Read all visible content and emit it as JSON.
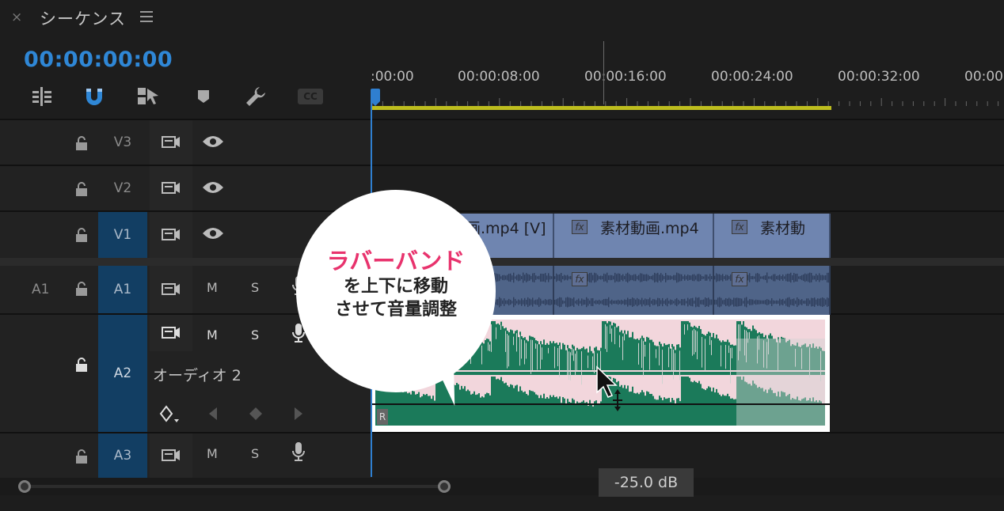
{
  "panel": {
    "close_glyph": "×",
    "title": "シーケンス",
    "timecode": "00:00:00:00"
  },
  "toolbar": {
    "icons": [
      "insert-edit-icon",
      "snap-magnet-icon",
      "linked-selection-icon",
      "marker-icon",
      "wrench-settings-icon",
      "closed-caption-icon"
    ],
    "cc_label": "CC"
  },
  "ruler": {
    "labels": [
      ":00:00",
      "00:00:08:00",
      "00:00:16:00",
      "00:00:24:00",
      "00:00:32:00",
      "00:00"
    ]
  },
  "tracks": {
    "v3": {
      "label": "V3"
    },
    "v2": {
      "label": "V2"
    },
    "v1": {
      "label": "V1"
    },
    "a1": {
      "label": "A1",
      "source": "A1",
      "m": "M",
      "s": "S"
    },
    "a2": {
      "label": "A2",
      "name": "オーディオ 2",
      "m": "M",
      "s": "S"
    },
    "a3": {
      "label": "A3",
      "m": "M",
      "s": "S"
    }
  },
  "clips": {
    "v1": [
      {
        "name": "画.mp4 [V]"
      },
      {
        "name": "素材動画.mp4"
      },
      {
        "name": "素材動"
      }
    ],
    "fx_label": "fx",
    "r_badge": "R"
  },
  "tooltip": {
    "value": "-25.0 dB"
  },
  "callout": {
    "heading": "ラバーバンド",
    "line1": "を上下に移動",
    "line2": "させて音量調整"
  },
  "colors": {
    "accent_blue": "#2f87d6",
    "track_selected": "#123e63",
    "video_clip": "#6f85b0",
    "audio_clip": "#4f6488",
    "waveform_green": "#1b7a5a",
    "work_area_bar": "#bdbd1e",
    "callout_pink": "#e8336d"
  }
}
